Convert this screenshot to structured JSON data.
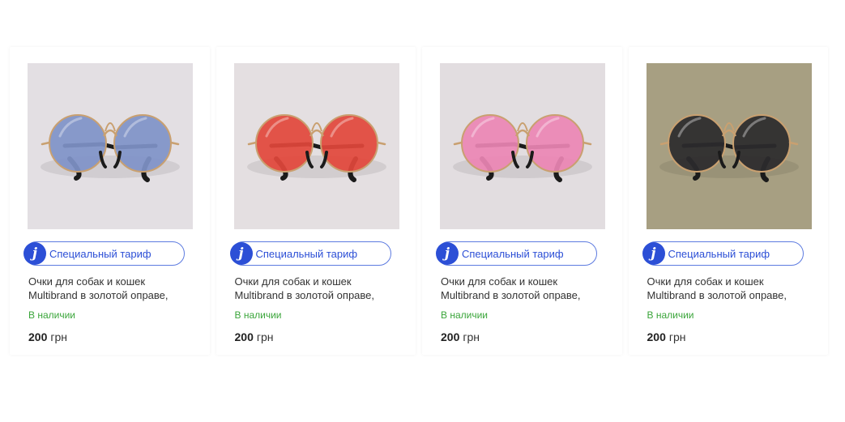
{
  "products": [
    {
      "tariff_label": "Специальный тариф",
      "title_line1": "Очки для собак и кошек",
      "title_line2": "Multibrand в золотой оправе,",
      "availability": "В наличии",
      "price": "200",
      "currency": "грн",
      "lens_color": "#7f92c8",
      "background_color": "#e3dfe3"
    },
    {
      "tariff_label": "Специальный тариф",
      "title_line1": "Очки для собак и кошек",
      "title_line2": "Multibrand в золотой оправе,",
      "availability": "В наличии",
      "price": "200",
      "currency": "грн",
      "lens_color": "#e2463b",
      "background_color": "#e4dfe1"
    },
    {
      "tariff_label": "Специальный тариф",
      "title_line1": "Очки для собак и кошек",
      "title_line2": "Multibrand в золотой оправе,",
      "availability": "В наличии",
      "price": "200",
      "currency": "грн",
      "lens_color": "#ec86b4",
      "background_color": "#e2dde0"
    },
    {
      "tariff_label": "Специальный тариф",
      "title_line1": "Очки для собак и кошек",
      "title_line2": "Multibrand в золотой оправе,",
      "availability": "В наличии",
      "price": "200",
      "currency": "грн",
      "lens_color": "#2b2a2c",
      "background_color": "#a79f82"
    }
  ],
  "colors": {
    "accent_blue": "#2c4fd6",
    "in_stock_green": "#3aa53a",
    "frame_gold": "#c9a070"
  }
}
